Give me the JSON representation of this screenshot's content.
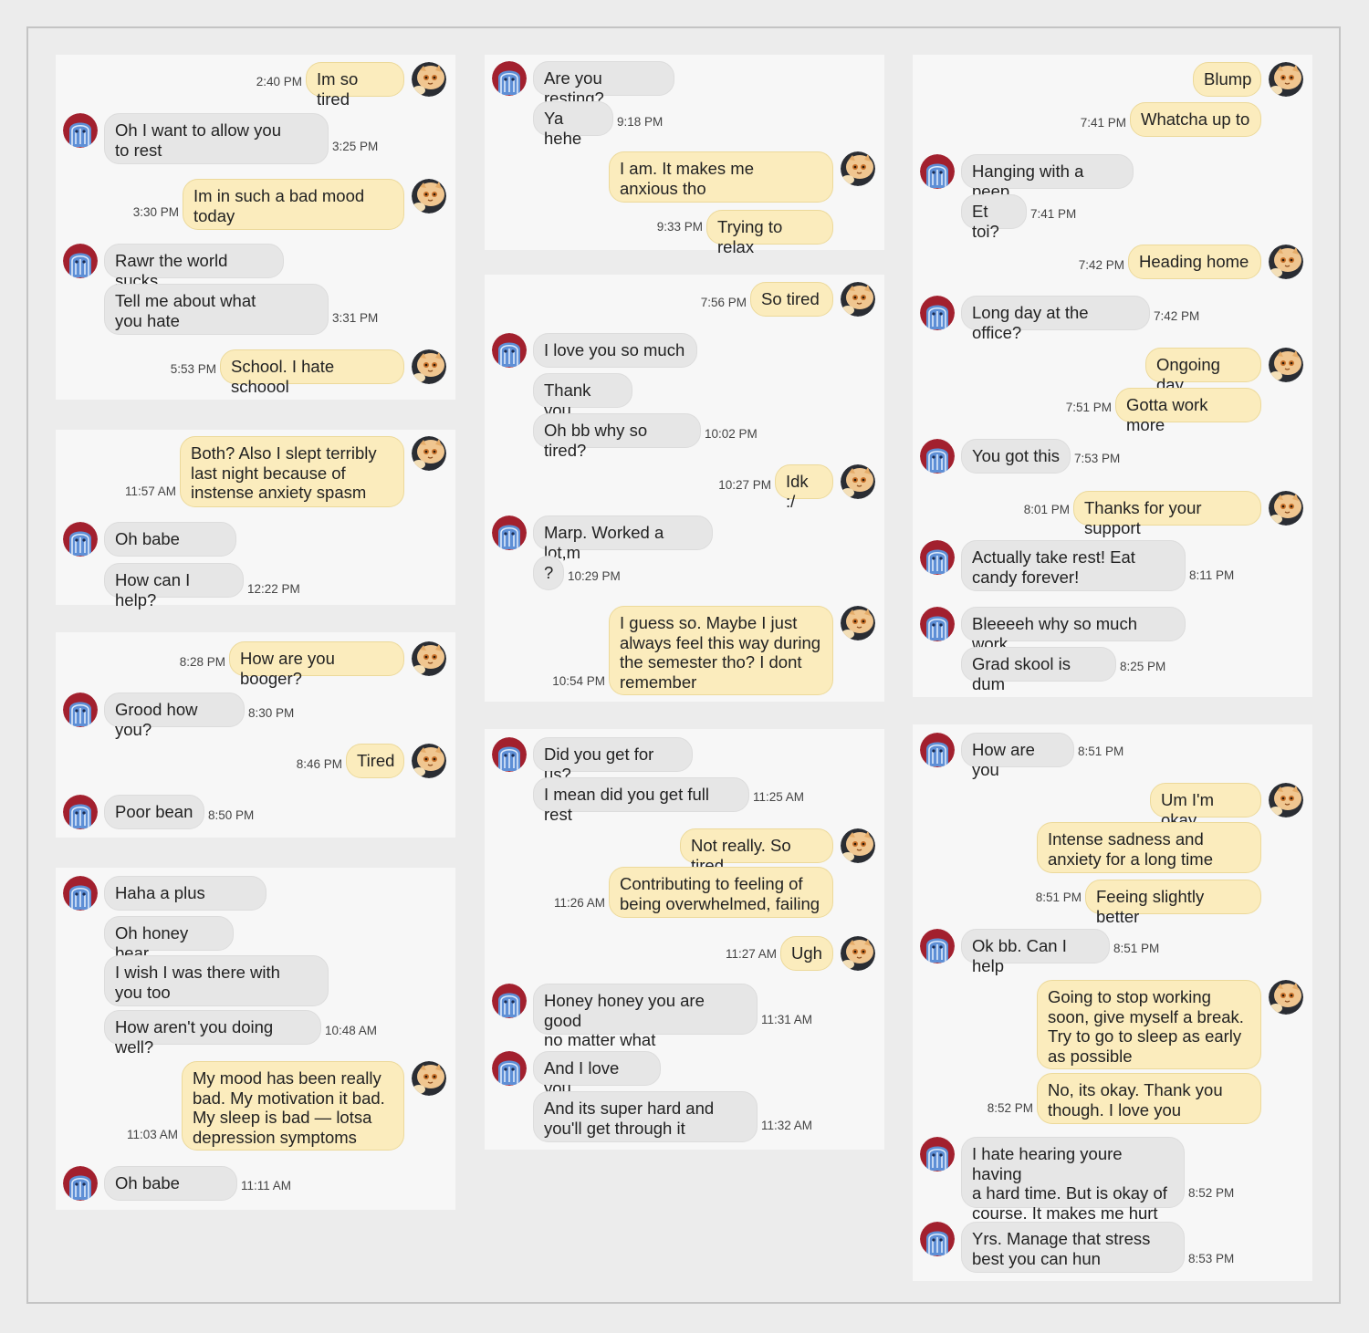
{
  "colors": {
    "page_background": "#ececec",
    "panel_background": "#f7f7f7",
    "incoming_bubble": "#e6e6e6",
    "outgoing_bubble": "#fbecbd",
    "incoming_avatar": "blue-ghost-avatar on red",
    "outgoing_avatar": "orange-cat-avatar on dark"
  },
  "panels": [
    {
      "messages": [
        {
          "from": "them",
          "text": "Im so tired",
          "time": "2:40 PM"
        },
        {
          "from": "me",
          "text": "Oh I want to allow you\nto rest",
          "time": "3:25 PM"
        },
        {
          "from": "them",
          "text": "Im in such a bad mood\ntoday",
          "time": "3:30 PM"
        },
        {
          "from": "me",
          "text": "Rawr the world sucks",
          "time": ""
        },
        {
          "from": "me",
          "text": "Tell me about what\nyou hate",
          "time": "3:31 PM"
        },
        {
          "from": "them",
          "text": "School. I hate schoool",
          "time": "5:53 PM"
        }
      ]
    },
    {
      "messages": [
        {
          "from": "them",
          "text": "Both? Also I slept terribly\nlast night because of\ninstense anxiety spasm",
          "time": "11:57 AM"
        },
        {
          "from": "me",
          "text": "Oh babe",
          "time": ""
        },
        {
          "from": "me",
          "text": "How can I help?",
          "time": "12:22 PM"
        }
      ]
    },
    {
      "messages": [
        {
          "from": "them",
          "text": "How are you booger?",
          "time": "8:28 PM"
        },
        {
          "from": "me",
          "text": "Grood how you?",
          "time": "8:30 PM"
        },
        {
          "from": "them",
          "text": "Tired",
          "time": "8:46 PM"
        },
        {
          "from": "me",
          "text": "Poor bean",
          "time": "8:50 PM"
        }
      ]
    },
    {
      "messages": [
        {
          "from": "me",
          "text": "Haha a plus",
          "time": ""
        },
        {
          "from": "me",
          "text": "Oh honey bear",
          "time": ""
        },
        {
          "from": "me",
          "text": "I wish I was there with\nyou too",
          "time": ""
        },
        {
          "from": "me",
          "text": "How aren't you doing well?",
          "time": "10:48 AM"
        },
        {
          "from": "them",
          "text": "My mood has been really\nbad. My motivation it bad.\nMy sleep is bad — lotsa\ndepression symptoms",
          "time": "11:03 AM"
        },
        {
          "from": "me",
          "text": "Oh babe",
          "time": "11:11 AM"
        }
      ]
    },
    {
      "messages": [
        {
          "from": "me",
          "text": "Are you resting?",
          "time": ""
        },
        {
          "from": "me",
          "text": "Ya hehe",
          "time": "9:18 PM"
        },
        {
          "from": "them",
          "text": "I am. It makes me\nanxious tho",
          "time": ""
        },
        {
          "from": "them",
          "text": "Trying to relax",
          "time": "9:33 PM"
        }
      ]
    },
    {
      "messages": [
        {
          "from": "them",
          "text": "So tired",
          "time": "7:56 PM"
        },
        {
          "from": "me",
          "text": "I love you so much",
          "time": ""
        },
        {
          "from": "me",
          "text": "Thank you",
          "time": ""
        },
        {
          "from": "me",
          "text": "Oh bb why so tired?",
          "time": "10:02 PM"
        },
        {
          "from": "them",
          "text": "Idk :/",
          "time": "10:27 PM"
        },
        {
          "from": "me",
          "text": "Marp. Worked a lot,m",
          "time": ""
        },
        {
          "from": "me",
          "text": "?",
          "time": "10:29 PM"
        },
        {
          "from": "them",
          "text": "I guess so. Maybe I just\nalways feel this way during\nthe semester tho? I dont\nremember",
          "time": "10:54 PM"
        }
      ]
    },
    {
      "messages": [
        {
          "from": "me",
          "text": "Did you get for us?",
          "time": ""
        },
        {
          "from": "me",
          "text": "I mean did you get full rest",
          "time": "11:25 AM"
        },
        {
          "from": "them",
          "text": "Not really. So tired",
          "time": ""
        },
        {
          "from": "them",
          "text": "Contributing to feeling of\nbeing overwhelmed, failing",
          "time": "11:26 AM"
        },
        {
          "from": "them",
          "text": "Ugh",
          "time": "11:27 AM"
        },
        {
          "from": "me",
          "text": "Honey honey you are good\nno matter what",
          "time": "11:31 AM"
        },
        {
          "from": "me",
          "text": "And I love you",
          "time": ""
        },
        {
          "from": "me",
          "text": "And its super hard and\nyou'll get through it",
          "time": "11:32 AM"
        }
      ]
    },
    {
      "messages": [
        {
          "from": "them",
          "text": "Blump",
          "time": ""
        },
        {
          "from": "them",
          "text": "Whatcha up to",
          "time": "7:41 PM"
        },
        {
          "from": "me",
          "text": "Hanging with a peep",
          "time": ""
        },
        {
          "from": "me",
          "text": "Et toi?",
          "time": "7:41 PM"
        },
        {
          "from": "them",
          "text": "Heading home",
          "time": "7:42 PM"
        },
        {
          "from": "me",
          "text": "Long day at the office?",
          "time": "7:42 PM"
        },
        {
          "from": "them",
          "text": "Ongoing day",
          "time": ""
        },
        {
          "from": "them",
          "text": "Gotta work more",
          "time": "7:51 PM"
        },
        {
          "from": "me",
          "text": "You got this",
          "time": "7:53 PM"
        },
        {
          "from": "them",
          "text": "Thanks for your support",
          "time": "8:01 PM"
        },
        {
          "from": "me",
          "text": "Actually take rest! Eat\ncandy forever!",
          "time": "8:11 PM"
        },
        {
          "from": "me",
          "text": "Bleeeeh why so much work",
          "time": ""
        },
        {
          "from": "me",
          "text": "Grad skool is dum",
          "time": "8:25 PM"
        }
      ]
    },
    {
      "messages": [
        {
          "from": "me",
          "text": "How are you",
          "time": "8:51 PM"
        },
        {
          "from": "them",
          "text": "Um I'm okay",
          "time": ""
        },
        {
          "from": "them",
          "text": "Intense sadness and\nanxiety for a long time",
          "time": ""
        },
        {
          "from": "them",
          "text": "Feeing slightly better",
          "time": "8:51 PM"
        },
        {
          "from": "me",
          "text": "Ok bb. Can I help",
          "time": "8:51 PM"
        },
        {
          "from": "them",
          "text": "Going to stop working\nsoon, give myself a break.\nTry to go to sleep as early\nas possible",
          "time": ""
        },
        {
          "from": "them",
          "text": "No, its okay. Thank you\nthough. I love you",
          "time": "8:52 PM"
        },
        {
          "from": "me",
          "text": "I hate hearing youre having\na hard time.  But is okay of\ncourse. It makes me hurt",
          "time": "8:52 PM"
        },
        {
          "from": "me",
          "text": "Yrs. Manage that stress\nbest you can hun",
          "time": "8:53 PM"
        }
      ]
    }
  ]
}
